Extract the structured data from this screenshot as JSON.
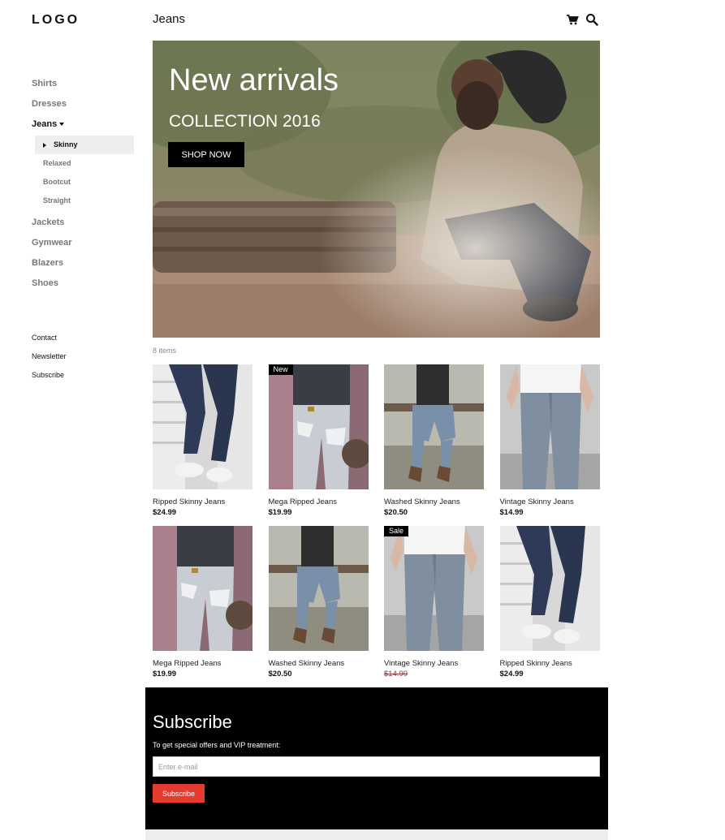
{
  "brand": {
    "logo": "LOGO"
  },
  "header": {
    "title": "Jeans",
    "icons": [
      "cart-icon",
      "search-icon"
    ]
  },
  "sidebar": {
    "categories_top": [
      "Shirts",
      "Dresses"
    ],
    "active_category": "Jeans",
    "subcategories": [
      "Skinny",
      "Relaxed",
      "Bootcut",
      "Straight"
    ],
    "active_subcategory": "Skinny",
    "categories_bottom": [
      "Jackets",
      "Gymwear",
      "Blazers",
      "Shoes"
    ],
    "links": [
      "Contact",
      "Newsletter",
      "Subscribe"
    ]
  },
  "hero": {
    "title": "New arrivals",
    "subtitle": "COLLECTION 2016",
    "button": "SHOP NOW"
  },
  "catalog": {
    "count": "8 items",
    "products": [
      {
        "name": "Ripped Skinny Jeans",
        "price": "$24.99",
        "badge": ""
      },
      {
        "name": "Mega Ripped Jeans",
        "price": "$19.99",
        "badge": "New"
      },
      {
        "name": "Washed Skinny Jeans",
        "price": "$20.50",
        "badge": ""
      },
      {
        "name": "Vintage Skinny Jeans",
        "price": "$14.99",
        "badge": ""
      },
      {
        "name": "Mega Ripped Jeans",
        "price": "$19.99",
        "badge": ""
      },
      {
        "name": "Washed Skinny Jeans",
        "price": "$20.50",
        "badge": ""
      },
      {
        "name": "Vintage Skinny Jeans",
        "price": "$14.99",
        "badge": "Sale"
      },
      {
        "name": "Ripped Skinny Jeans",
        "price": "$24.99",
        "badge": ""
      }
    ]
  },
  "subscribe": {
    "title": "Subscribe",
    "text": "To get special offers and VIP treatment:",
    "placeholder": "Enter e-mail",
    "button": "Subscribe"
  },
  "colors": {
    "accent": "#e53a2e",
    "sale_price": "#8a3b3b"
  }
}
